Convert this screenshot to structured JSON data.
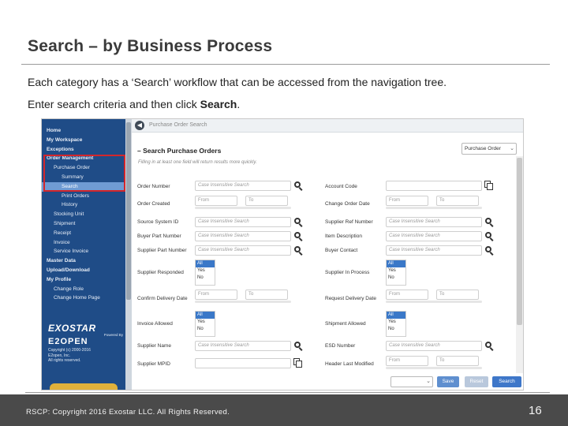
{
  "slide": {
    "title": "Search – by Business Process",
    "line1": "Each category has a ‘Search’ workflow that can be accessed from the navigation tree.",
    "line2_prefix": "Enter search criteria and then click ",
    "line2_bold": "Search",
    "line2_suffix": "."
  },
  "nav": {
    "items": [
      {
        "label": "Home"
      },
      {
        "label": "My Workspace"
      },
      {
        "label": "Exceptions"
      },
      {
        "label": "Order Management"
      },
      {
        "label": "Purchase Order"
      },
      {
        "label": "Summary"
      },
      {
        "label": "Search"
      },
      {
        "label": "Print Orders"
      },
      {
        "label": "History"
      },
      {
        "label": "Stocking Unit"
      },
      {
        "label": "Shipment"
      },
      {
        "label": "Receipt"
      },
      {
        "label": "Invoice"
      },
      {
        "label": "Service Invoice"
      },
      {
        "label": "Master Data"
      },
      {
        "label": "Upload/Download"
      },
      {
        "label": "My Profile"
      },
      {
        "label": "Change Role"
      },
      {
        "label": "Change Home Page"
      }
    ],
    "brand": {
      "exostar": "EXOSTAR",
      "powered_by": "Powered By",
      "e2open": "E2OPEN",
      "copyright_1": "Copyright (c) 2000-2016",
      "copyright_2": "E2open, Inc.",
      "copyright_3": "All rights reserved."
    }
  },
  "panel": {
    "breadcrumb": "Purchase Order Search",
    "section_title": "– Search Purchase Orders",
    "note": "Filling in at least one field will return results more quickly.",
    "doc_type": "Purchase Order",
    "case_placeholder": "Case Insensitive Search",
    "from_placeholder": "From",
    "to_placeholder": "To",
    "list_options": [
      "All",
      "Yes",
      "No"
    ],
    "labels": {
      "order_number": "Order Number",
      "account_code": "Account Code",
      "order_created": "Order Created",
      "change_order_date": "Change Order Date",
      "source_system_id": "Source System ID",
      "supplier_ref_number": "Supplier Ref Number",
      "buyer_part_number": "Buyer Part Number",
      "item_description": "Item Description",
      "supplier_part_number": "Supplier Part Number",
      "buyer_contact": "Buyer Contact",
      "supplier_responded": "Supplier Responded",
      "supplier_in_process": "Supplier In Process",
      "confirm_delivery_date": "Confirm Delivery Date",
      "request_delivery_date": "Request Delivery Date",
      "invoice_allowed": "Invoice Allowed",
      "shipment_allowed": "Shipment Allowed",
      "supplier_name": "Supplier Name",
      "esd_number": "ESD Number",
      "supplier_mpid": "Supplier MPID",
      "header_last_modified": "Header Last Modified"
    },
    "buttons": {
      "save": "Save",
      "reset": "Reset",
      "search": "Search"
    }
  },
  "footer": {
    "copyright": "RSCP: Copyright 2016 Exostar LLC. All Rights Reserved.",
    "page_number": "16"
  }
}
